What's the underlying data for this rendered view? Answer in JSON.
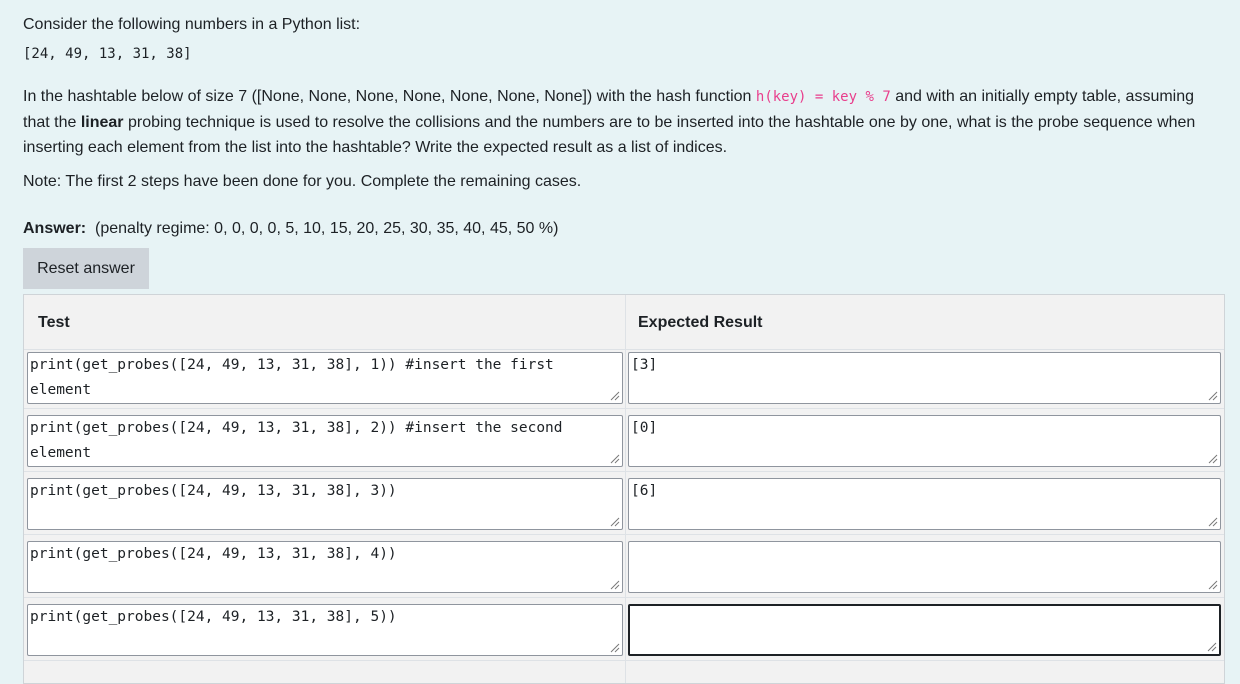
{
  "question": {
    "intro": "Consider the following numbers in a Python list:",
    "list_literal": "[24, 49, 13, 31, 38]",
    "desc_part1": "In the hashtable below of size 7 ([None, None, None, None, None, None, None]) with the hash function ",
    "hash_code": "h(key) = key % 7",
    "desc_part2": " and with an initially empty table, assuming that the ",
    "desc_bold": "linear",
    "desc_part3": " probing technique is used to resolve the collisions and the numbers are to be inserted into the hashtable one by one, what is the probe sequence when inserting each element from the list into the hashtable? Write the expected result as a list of indices.",
    "note": "Note: The first 2 steps have been done for you. Complete the remaining cases."
  },
  "answer": {
    "label": "Answer:",
    "penalty": "(penalty regime: 0, 0, 0, 0, 5, 10, 15, 20, 25, 30, 35, 40, 45, 50 %)",
    "reset_label": "Reset answer"
  },
  "table": {
    "headers": {
      "test": "Test",
      "expected": "Expected Result"
    },
    "rows": [
      {
        "test": "print(get_probes([24, 49, 13, 31, 38], 1)) #insert the first element",
        "expected": "[3]"
      },
      {
        "test": "print(get_probes([24, 49, 13, 31, 38], 2)) #insert the second element",
        "expected": "[0]"
      },
      {
        "test": "print(get_probes([24, 49, 13, 31, 38], 3))",
        "expected": "[6]"
      },
      {
        "test": "print(get_probes([24, 49, 13, 31, 38], 4))",
        "expected": ""
      },
      {
        "test": "print(get_probes([24, 49, 13, 31, 38], 5))",
        "expected": ""
      }
    ]
  }
}
